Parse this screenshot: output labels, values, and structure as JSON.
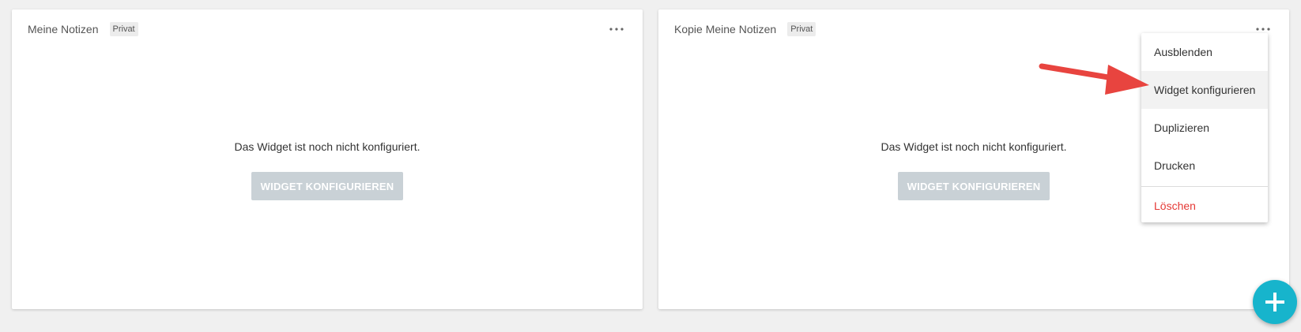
{
  "widgets": [
    {
      "title": "Meine Notizen",
      "badge": "Privat",
      "message": "Das Widget ist noch nicht konfiguriert.",
      "button_label": "WIDGET KONFIGURIEREN",
      "more_icon": "more-horizontal-icon"
    },
    {
      "title": "Kopie Meine Notizen",
      "badge": "Privat",
      "message": "Das Widget ist noch nicht konfiguriert.",
      "button_label": "WIDGET KONFIGURIEREN",
      "more_icon": "more-horizontal-icon"
    }
  ],
  "context_menu": {
    "items": [
      {
        "label": "Ausblenden"
      },
      {
        "label": "Widget konfigurieren",
        "highlighted": true
      },
      {
        "label": "Duplizieren"
      },
      {
        "label": "Drucken"
      },
      {
        "label": "Löschen",
        "color": "#e53935"
      }
    ]
  },
  "annotation": {
    "icon": "red-arrow-icon",
    "color": "#e8443f"
  },
  "fab": {
    "icon": "plus-icon",
    "color": "#17b4cc"
  }
}
